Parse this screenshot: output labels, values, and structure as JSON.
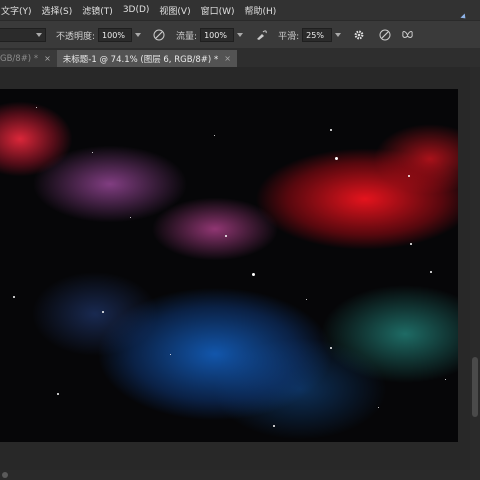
{
  "menubar": {
    "items": [
      "文字(Y)",
      "选择(S)",
      "滤镜(T)",
      "3D(D)",
      "视图(V)",
      "窗口(W)",
      "帮助(H)"
    ]
  },
  "options": {
    "opacity_label": "不透明度:",
    "opacity_value": "100%",
    "flow_label": "流量:",
    "flow_value": "100%",
    "smoothing_label": "平滑:",
    "smoothing_value": "25%"
  },
  "tabs": {
    "inactive_label": "GB/8#) *",
    "active_label": "未标题-1 @ 74.1% (图层 6, RGB/8#) *",
    "close_symbol": "×"
  },
  "icons": {
    "pressure_opacity": "pen-pressure-icon",
    "airbrush": "airbrush-icon",
    "smoothing_settings": "gear-icon",
    "pressure_size": "pen-pressure-size-icon",
    "symmetry": "butterfly-icon"
  },
  "colors": {
    "menubar_bg": "#323232",
    "optionsbar_bg": "#3a3a3a",
    "active_tab_bg": "#535353",
    "workspace_bg": "#282828"
  }
}
